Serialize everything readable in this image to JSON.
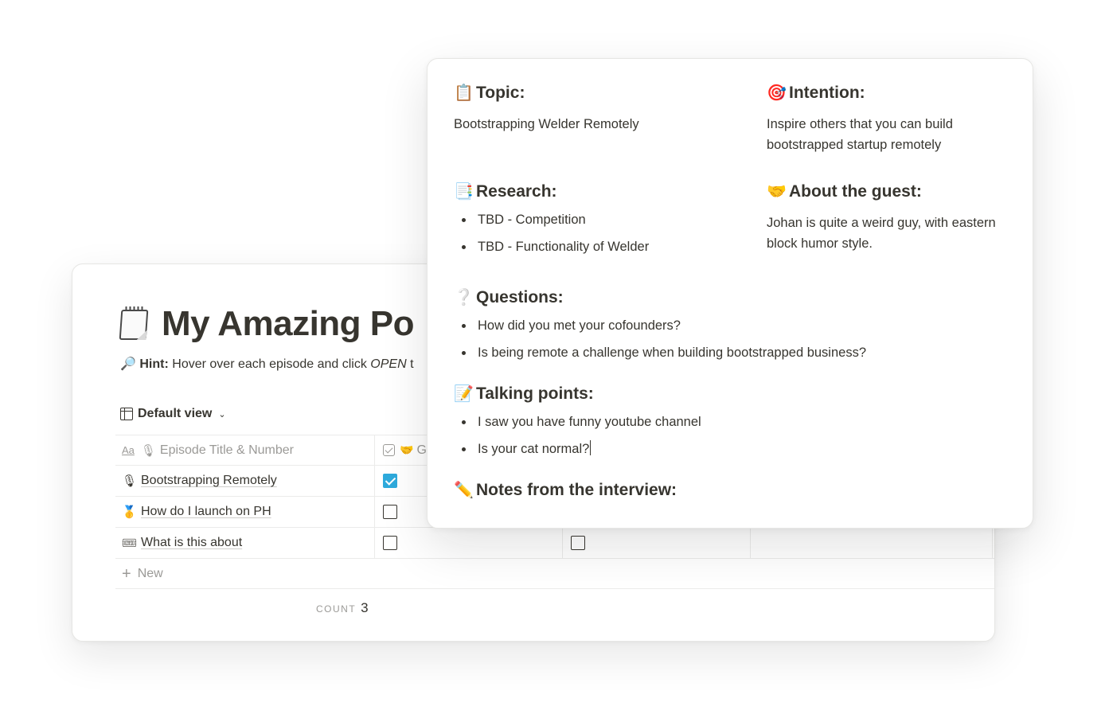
{
  "database_page": {
    "title_emoji": "notepad-icon",
    "title": "My Amazing Po",
    "hint_label": "Hint:",
    "hint_text": "Hover over each episode and click ",
    "hint_open": "OPEN",
    "hint_tail": " t",
    "view_label": "Default view",
    "columns": {
      "title_prefix": "Aa",
      "title": "Episode Title & Number",
      "guest_partial": "G"
    },
    "rows": [
      {
        "title": "Bootstrapping Remotely",
        "icon": "microphone-icon",
        "checked": true
      },
      {
        "title": "How do I launch on PH",
        "icon": "medal-icon",
        "checked": false
      },
      {
        "title": "What is this about",
        "icon": "ticket-icon",
        "checked": false
      }
    ],
    "new_label": "New",
    "count_label": "COUNT",
    "count_value": "3"
  },
  "episode_page": {
    "topic": {
      "heading": "Topic:",
      "text": "Bootstrapping Welder Remotely"
    },
    "intention": {
      "heading": "Intention:",
      "text": "Inspire others that you can build bootstrapped startup remotely"
    },
    "research": {
      "heading": "Research:",
      "items": [
        "TBD - Competition",
        "TBD - Functionality of Welder"
      ]
    },
    "about_guest": {
      "heading": "About the guest:",
      "text": "Johan is quite a weird guy, with eastern block humor style."
    },
    "questions": {
      "heading": "Questions:",
      "items": [
        "How did you met your cofounders?",
        "Is being remote a challenge when building bootstrapped business?"
      ]
    },
    "talking_points": {
      "heading": "Talking points:",
      "items": [
        "I saw you have funny youtube channel",
        "Is your cat normal?"
      ]
    },
    "notes": {
      "heading": "Notes from the interview:"
    }
  }
}
